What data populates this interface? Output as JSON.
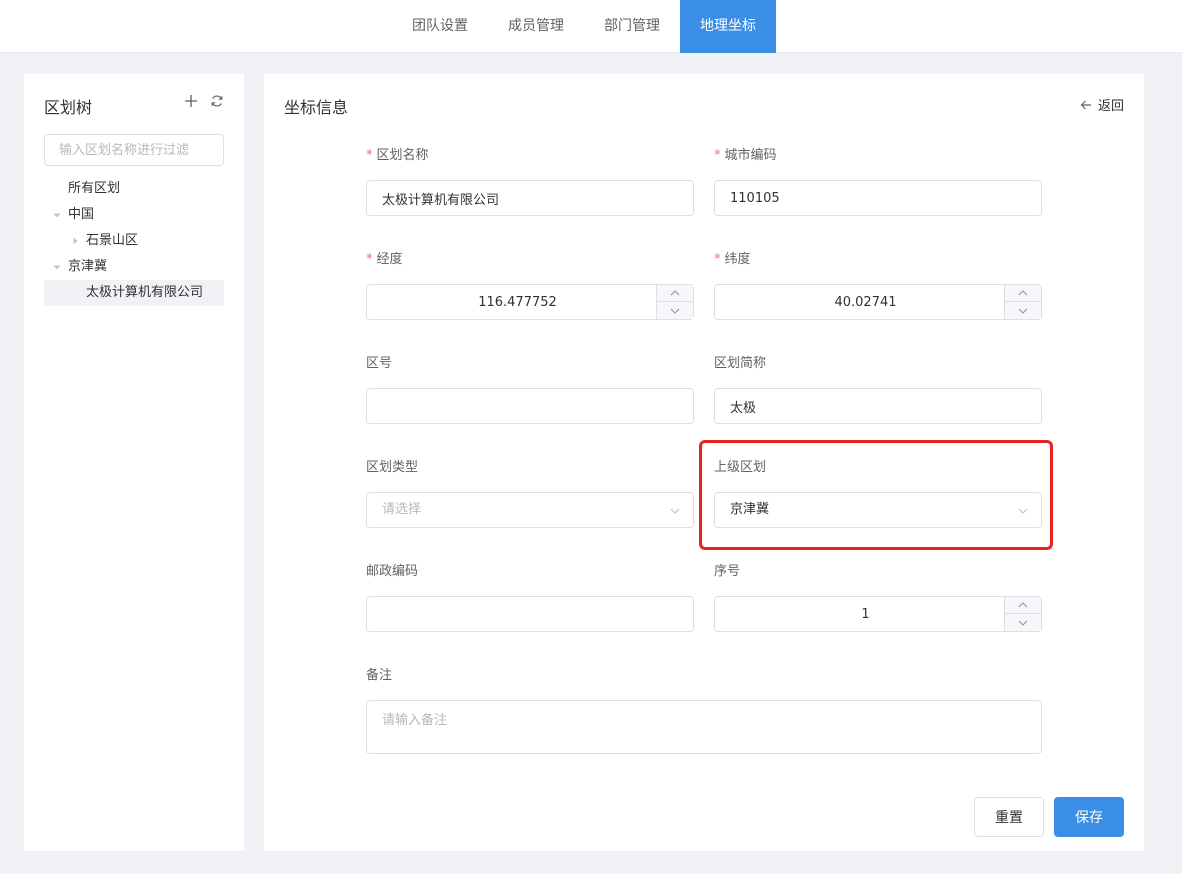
{
  "nav": {
    "tabs": [
      {
        "label": "团队设置"
      },
      {
        "label": "成员管理"
      },
      {
        "label": "部门管理"
      },
      {
        "label": "地理坐标",
        "active": true
      }
    ],
    "active_color": "#3a8ee6"
  },
  "sidebar": {
    "title": "区划树",
    "filter_placeholder": "输入区划名称进行过滤",
    "tree": [
      {
        "label": "所有区划"
      },
      {
        "label": "中国",
        "expanded": true
      },
      {
        "label": "石景山区",
        "expanded": false
      },
      {
        "label": "京津冀",
        "expanded": true
      },
      {
        "label": "太极计算机有限公司",
        "selected": true
      }
    ]
  },
  "form": {
    "title": "坐标信息",
    "back_label": "返回",
    "region_name": {
      "label": "区划名称",
      "value": "太极计算机有限公司"
    },
    "city_code": {
      "label": "城市编码",
      "value": "110105"
    },
    "longitude": {
      "label": "经度",
      "value": "116.477752"
    },
    "latitude": {
      "label": "纬度",
      "value": "40.02741"
    },
    "area_code": {
      "label": "区号",
      "value": ""
    },
    "short_name": {
      "label": "区划简称",
      "value": "太极"
    },
    "region_type": {
      "label": "区划类型",
      "placeholder": "请选择"
    },
    "parent_region": {
      "label": "上级区划",
      "value": "京津冀"
    },
    "postal_code": {
      "label": "邮政编码",
      "value": ""
    },
    "sort_order": {
      "label": "序号",
      "value": "1"
    },
    "remark": {
      "label": "备注",
      "placeholder": "请输入备注"
    },
    "reset_label": "重置",
    "save_label": "保存",
    "required_mark": "*"
  },
  "highlight_color": "#e5251e"
}
